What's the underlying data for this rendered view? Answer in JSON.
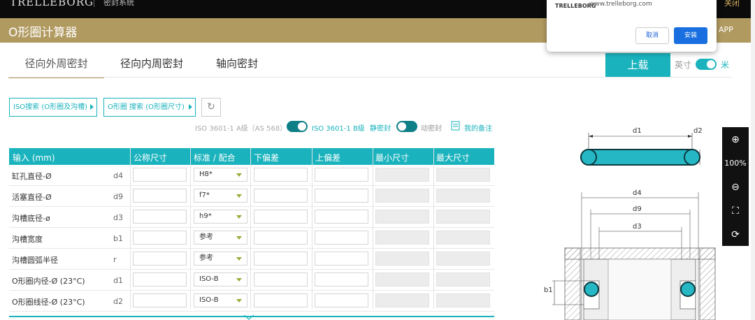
{
  "topbar": {
    "logo": "TRELLEBORG",
    "subtitle": "密封系统",
    "right_text": "关闭"
  },
  "titlebar": {
    "title": "O形圈计算器",
    "app_text": "APP"
  },
  "tabs": [
    {
      "label": "径向外周密封"
    },
    {
      "label": "径向内周密封"
    },
    {
      "label": "轴向密封"
    }
  ],
  "toolbar": {
    "upload_label": "上载",
    "unit_imperial": "英寸",
    "unit_metric": "米"
  },
  "search": {
    "btn1_label": "ISO搜索 (O形圈及沟槽)",
    "btn2_label": "O形圈 搜索 (O形圈尺寸)",
    "refresh_icon": "↻"
  },
  "options": {
    "iso_a": "ISO 3601-1 A级（AS 568）",
    "iso_b": "ISO 3601-1 B级",
    "static": "静密封",
    "dynamic": "动密封",
    "notes": "我的备注"
  },
  "table": {
    "headers": [
      "输入 (mm)",
      "公称尺寸",
      "标准 / 配合",
      "下偏差",
      "上偏差",
      "最小尺寸",
      "最大尺寸"
    ],
    "rows": [
      {
        "label": "缸孔直径-Ø",
        "sym": "d4",
        "select": "H8*"
      },
      {
        "label": "活塞直径-Ø",
        "sym": "d9",
        "select": "f7*"
      },
      {
        "label": "沟槽底径-ø",
        "sym": "d3",
        "select": "h9*"
      },
      {
        "label": "沟槽宽度",
        "sym": "b1",
        "select": "参考"
      },
      {
        "label": "沟槽圆弧半径",
        "sym": "r",
        "select": "参考"
      },
      {
        "label": "O形圈内径-Ø (23°C)",
        "sym": "d1",
        "select": "ISO-B"
      },
      {
        "label": "O形圈线径-Ø (23°C)",
        "sym": "d2",
        "select": "ISO-B"
      }
    ]
  },
  "tools": {
    "zoom_in": "⊕",
    "zoom_level": "100%",
    "zoom_out": "⊖",
    "fullscreen": "⛶",
    "rotate": "⟳"
  },
  "popup": {
    "logo": "TRELLEBORG",
    "url": "www.trelleborg.com",
    "cancel": "取消",
    "install": "安装"
  },
  "diagram": {
    "labels": {
      "d1": "d1",
      "d2": "d2",
      "d4": "d4",
      "d9": "d9",
      "d3": "d3",
      "b1": "b1"
    }
  },
  "colors": {
    "accent": "#1ab3bd",
    "gold": "#b19a60",
    "oring": "#25b8c4"
  }
}
